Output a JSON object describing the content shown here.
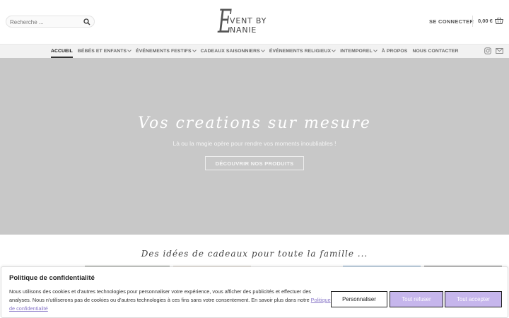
{
  "header": {
    "search": {
      "placeholder": "Recherche ..."
    },
    "logo": {
      "initial": "E",
      "text": "VENT BY NANIE"
    },
    "login_label": "SE CONNECTER",
    "cart_total": "0,00 €"
  },
  "nav": {
    "items": [
      {
        "label": "ACCUEIL"
      },
      {
        "label": "BÉBÉS ET ENFANTS"
      },
      {
        "label": "ÉVÉNEMENTS FESTIFS"
      },
      {
        "label": "CADEAUX SAISONNIERS"
      },
      {
        "label": "ÉVÉNEMENTS RELIGIEUX"
      },
      {
        "label": "INTEMPOREL"
      },
      {
        "label": "À PROPOS"
      },
      {
        "label": "NOUS CONTACTER"
      }
    ]
  },
  "hero": {
    "title": "Vos creations sur mesure",
    "subtitle": "Là ou la magie opère pour rendre vos moments inoubliables !",
    "button": "DÉCOUVRIR NOS PRODUITS"
  },
  "section": {
    "title": "Des idées de cadeaux pour toute la famille ..."
  },
  "cookie": {
    "title": "Politique de confidentialité",
    "text": "Nous utilisons des cookies et d'autres technologies pour personnaliser votre expérience, vous afficher des publicités et effectuer des analyses. Nous n'utiliserons pas de cookies ou d'autres technologies à ces fins sans votre consentement. En savoir plus dans notre",
    "link": "Politique de confidentialité",
    "buttons": {
      "customize": "Personnaliser",
      "refuse": "Tout refuser",
      "accept": "Tout accepter"
    }
  },
  "colors": {
    "hero_bg": "#c8c8c8",
    "accent_purple": "#c6b6ec",
    "link_purple": "#8a78c9",
    "nav_bg": "#f2f2f2"
  }
}
